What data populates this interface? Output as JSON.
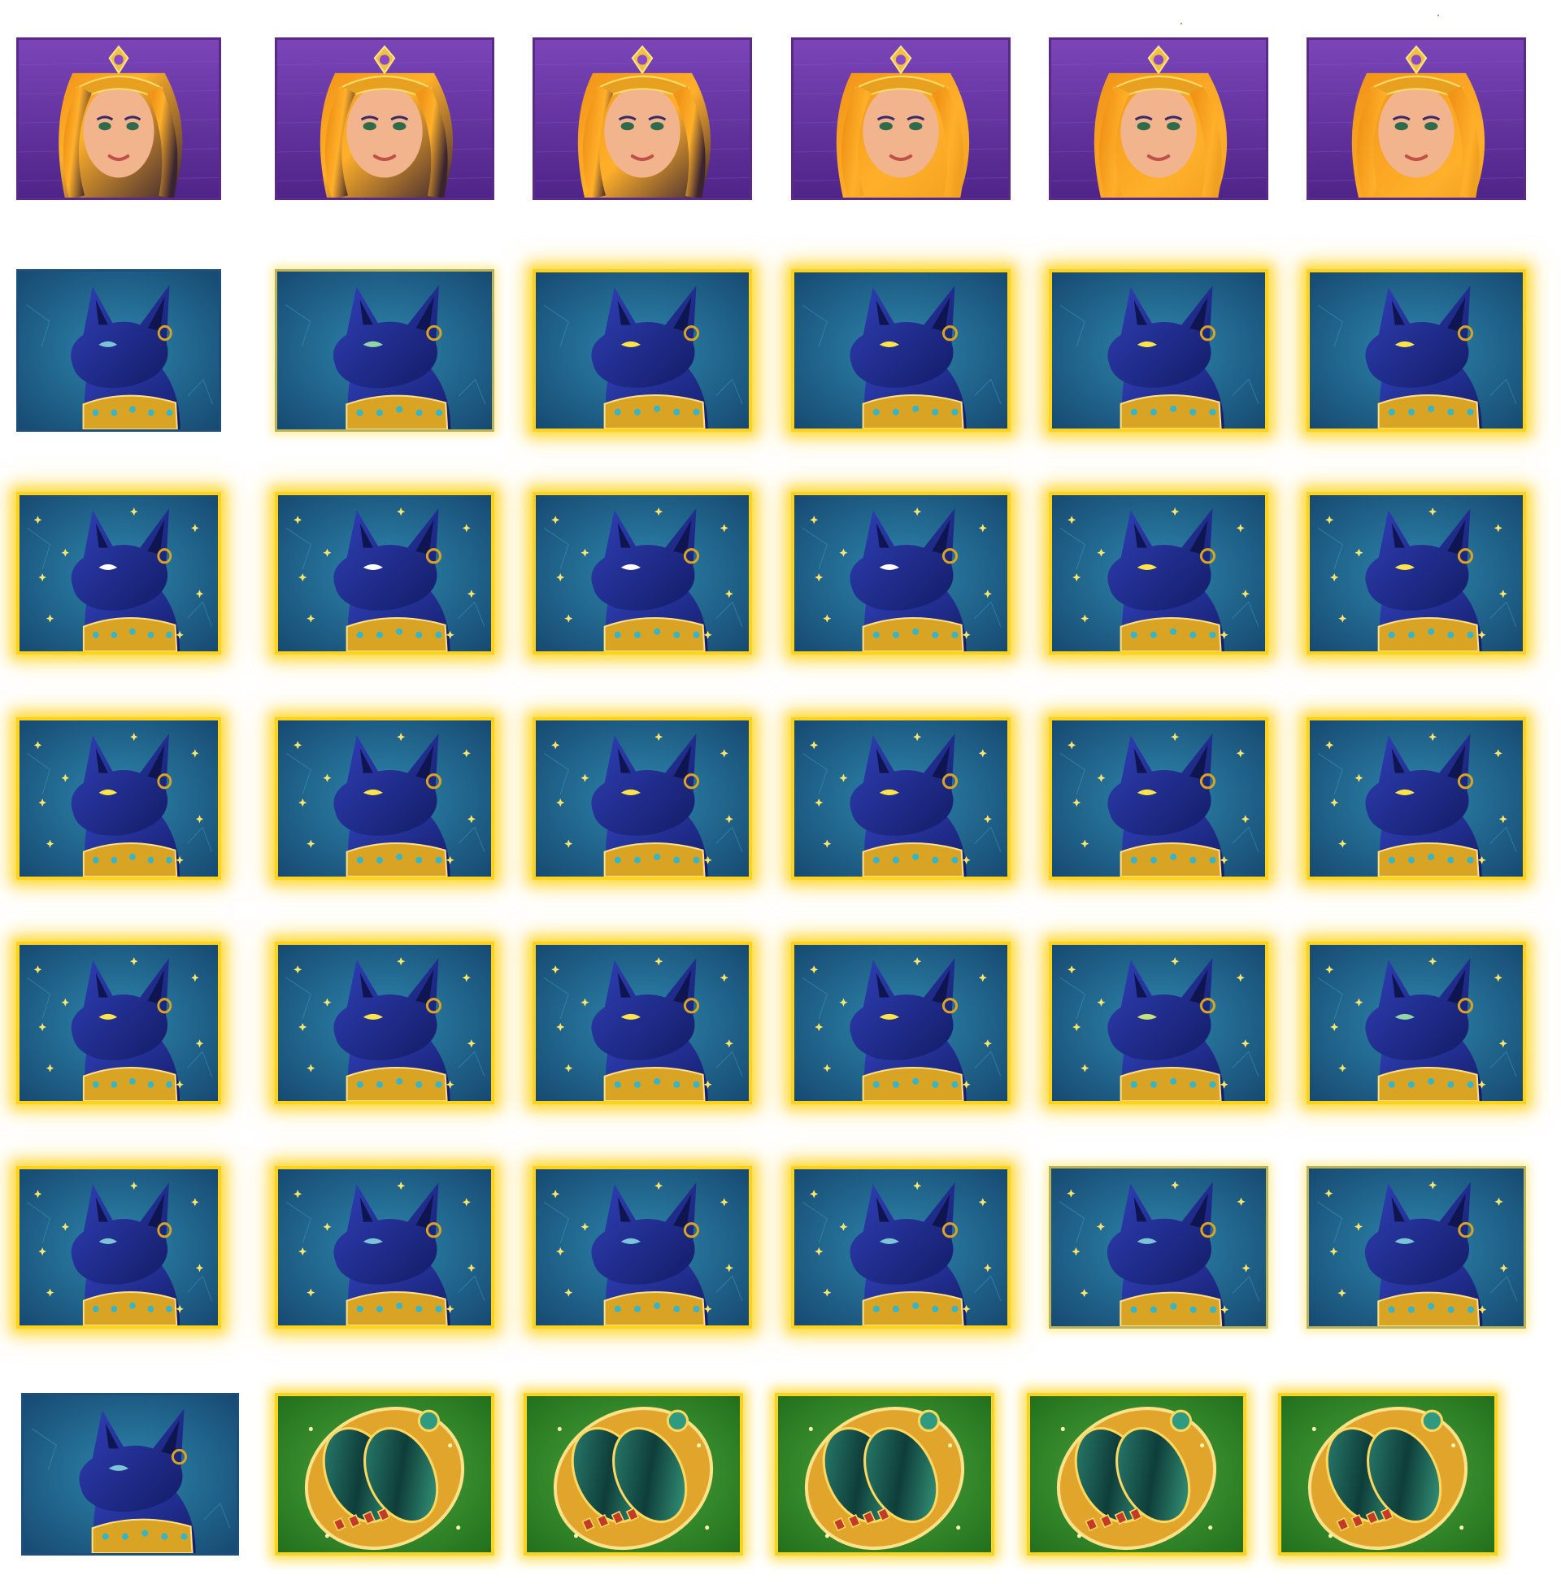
{
  "sprite_sheet": {
    "background": "#ffffff",
    "symbol_colors": {
      "queen_background": "#6a38a8",
      "cat_background": "#1f6a8f",
      "scarab_background": "#2f8a2a",
      "glow_frame": "#ffd21f",
      "cat_body": "#1c2a8c",
      "collar_gold": "#d9a323",
      "hair_fire": "#f19418"
    },
    "rows": [
      {
        "symbol": "queen-portrait",
        "frames": [
          {
            "variant": "queen",
            "hair_glow": 0.0
          },
          {
            "variant": "queen",
            "hair_glow": 0.2
          },
          {
            "variant": "queen",
            "hair_glow": 0.4
          },
          {
            "variant": "queen",
            "hair_glow": 0.6
          },
          {
            "variant": "queen",
            "hair_glow": 0.85
          },
          {
            "variant": "queen",
            "hair_glow": 1.0
          }
        ]
      },
      {
        "symbol": "bastet-cat",
        "frames": [
          {
            "variant": "cat",
            "frame": "plain",
            "eye": "#7cc4d8"
          },
          {
            "variant": "cat",
            "frame": "soft",
            "eye": "#8fd6a8"
          },
          {
            "variant": "cat",
            "frame": "glow",
            "eye": "#ffe44a"
          },
          {
            "variant": "cat",
            "frame": "glow",
            "eye": "#ffe44a"
          },
          {
            "variant": "cat",
            "frame": "glow",
            "eye": "#ffe44a"
          },
          {
            "variant": "cat",
            "frame": "glow",
            "eye": "#ffe44a"
          }
        ]
      },
      {
        "symbol": "bastet-cat-sparkle",
        "frames": [
          {
            "variant": "cat",
            "frame": "glow",
            "eye": "#ffffff",
            "sparkles": true
          },
          {
            "variant": "cat",
            "frame": "glow",
            "eye": "#ffffff",
            "sparkles": true
          },
          {
            "variant": "cat",
            "frame": "glow",
            "eye": "#ffffff",
            "sparkles": true
          },
          {
            "variant": "cat",
            "frame": "glow",
            "eye": "#ffffff",
            "sparkles": true
          },
          {
            "variant": "cat",
            "frame": "glow",
            "eye": "#ffe44a",
            "sparkles": true
          },
          {
            "variant": "cat",
            "frame": "glow",
            "eye": "#ffe44a",
            "sparkles": true
          }
        ]
      },
      {
        "symbol": "bastet-cat-sparkle",
        "frames": [
          {
            "variant": "cat",
            "frame": "glow",
            "eye": "#ffe44a",
            "sparkles": true
          },
          {
            "variant": "cat",
            "frame": "glow",
            "eye": "#ffe44a",
            "sparkles": true
          },
          {
            "variant": "cat",
            "frame": "glow",
            "eye": "#ffe44a",
            "sparkles": true
          },
          {
            "variant": "cat",
            "frame": "glow",
            "eye": "#ffe44a",
            "sparkles": true
          },
          {
            "variant": "cat",
            "frame": "glow",
            "eye": "#ffe44a",
            "sparkles": true
          },
          {
            "variant": "cat",
            "frame": "glow",
            "eye": "#ffe44a",
            "sparkles": true
          }
        ]
      },
      {
        "symbol": "bastet-cat-sparkle",
        "frames": [
          {
            "variant": "cat",
            "frame": "glow",
            "eye": "#ffe44a",
            "sparkles": true
          },
          {
            "variant": "cat",
            "frame": "glow",
            "eye": "#ffe44a",
            "sparkles": true
          },
          {
            "variant": "cat",
            "frame": "glow",
            "eye": "#ffe44a",
            "sparkles": true
          },
          {
            "variant": "cat",
            "frame": "glow",
            "eye": "#ffe44a",
            "sparkles": true
          },
          {
            "variant": "cat",
            "frame": "glow",
            "eye": "#c8e27a",
            "sparkles": true
          },
          {
            "variant": "cat",
            "frame": "glow",
            "eye": "#8fd6a8",
            "sparkles": true
          }
        ]
      },
      {
        "symbol": "bastet-cat-fade",
        "frames": [
          {
            "variant": "cat",
            "frame": "glow",
            "eye": "#7cc4d8",
            "sparkles": true
          },
          {
            "variant": "cat",
            "frame": "glow",
            "eye": "#7cc4d8",
            "sparkles": true
          },
          {
            "variant": "cat",
            "frame": "glow",
            "eye": "#7cc4d8",
            "sparkles": true
          },
          {
            "variant": "cat",
            "frame": "glow",
            "eye": "#7cc4d8",
            "sparkles": true
          },
          {
            "variant": "cat",
            "frame": "soft",
            "eye": "#7cc4d8",
            "sparkles": true
          },
          {
            "variant": "cat",
            "frame": "soft",
            "eye": "#7cc4d8",
            "sparkles": true
          }
        ]
      },
      {
        "symbol": "cat-and-scarab",
        "frames": [
          {
            "variant": "cat",
            "frame": "plain",
            "eye": "#7cc4d8"
          },
          {
            "variant": "scarab",
            "frame": "glow"
          },
          {
            "variant": "scarab",
            "frame": "glow"
          },
          {
            "variant": "scarab",
            "frame": "glow"
          },
          {
            "variant": "scarab",
            "frame": "glow"
          },
          {
            "variant": "scarab",
            "frame": "glow"
          }
        ]
      }
    ]
  }
}
